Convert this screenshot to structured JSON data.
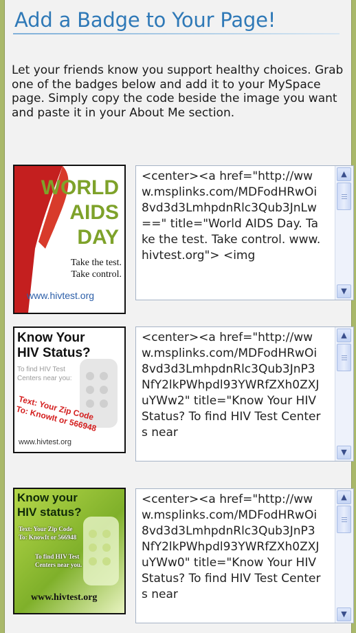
{
  "title": "Add a Badge to Your Page!",
  "intro": "Let your friends know you support healthy choices. Grab one of the badges below and add it to your MySpace page. Simply copy the code beside the image you want and paste it in your About Me section.",
  "badges": [
    {
      "lines": [
        "WORLD",
        "AIDS",
        "DAY",
        "Take the test.",
        "Take control.",
        "www.hivtest.org"
      ],
      "code": "<center><a href=\"http://www.msplinks.com/MDFodHRwOi8vd3d3LmhpdnRlc3Qub3JnLw==\" title=\"World AIDS Day. Take the test. Take control. www.hivtest.org\"> <img"
    },
    {
      "lines": [
        "Know Your",
        "HIV Status?",
        "To find HIV Test",
        "Centers near you:",
        "Text: Your Zip Code",
        "To: KnowIt or 566948",
        "www.hivtest.org"
      ],
      "code": "<center><a href=\"http://www.msplinks.com/MDFodHRwOi8vd3d3LmhpdnRlc3Qub3JnP3NfY2lkPWhpdl93YWRfZXh0ZXJuYWw2\" title=\"Know Your HIV Status? To find HIV Test Centers near"
    },
    {
      "lines": [
        "Know your",
        "HIV status?",
        "Text: Your Zip Code",
        "To: KnowIt or 566948",
        "To find HIV Test",
        "Centers near you.",
        "www.hivtest.org"
      ],
      "code": "<center><a href=\"http://www.msplinks.com/MDFodHRwOi8vd3d3LmhpdnRlc3Qub3JnP3NfY2lkPWhpdl93YWRfZXh0ZXJuYWw0\" title=\"Know Your HIV Status? To find HIV Test Centers near"
    }
  ],
  "scroll": {
    "up_icon": "arrow-up-icon",
    "down_icon": "arrow-down-icon"
  }
}
